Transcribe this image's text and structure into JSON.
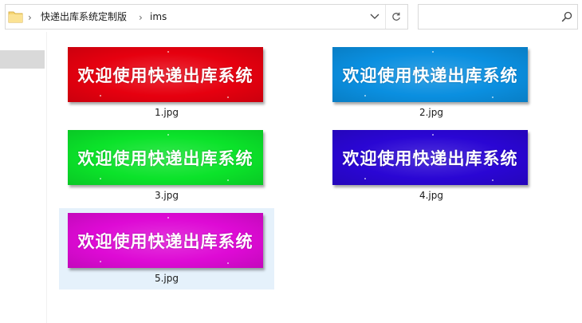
{
  "address_bar": {
    "breadcrumbs": [
      "快递出库系统定制版",
      "ims"
    ],
    "dropdown_icon": "chevron-down-icon",
    "refresh_icon": "refresh-icon"
  },
  "search": {
    "placeholder": "",
    "icon": "search-icon"
  },
  "files": [
    {
      "name": "1.jpg",
      "caption": "欢迎使用快递出库系统",
      "color": "#e6000f",
      "selected": false
    },
    {
      "name": "2.jpg",
      "caption": "欢迎使用快递出库系统",
      "color": "#0a8fe0",
      "selected": false
    },
    {
      "name": "3.jpg",
      "caption": "欢迎使用快递出库系统",
      "color": "#0be32a",
      "selected": false
    },
    {
      "name": "4.jpg",
      "caption": "欢迎使用快递出库系统",
      "color": "#2a06d4",
      "selected": false
    },
    {
      "name": "5.jpg",
      "caption": "欢迎使用快递出库系统",
      "color": "#de0ad5",
      "selected": true
    }
  ]
}
